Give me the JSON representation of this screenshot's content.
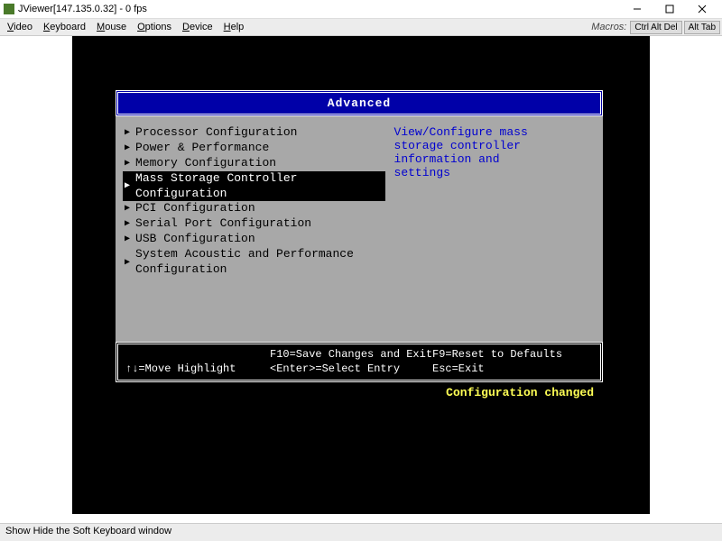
{
  "window": {
    "title": "JViewer[147.135.0.32] - 0 fps",
    "min_label": "Minimize",
    "max_label": "Maximize",
    "close_label": "Close"
  },
  "menus": {
    "items": [
      "Video",
      "Keyboard",
      "Mouse",
      "Options",
      "Device",
      "Help"
    ],
    "macros_label": "Macros:",
    "macro_buttons": [
      "Ctrl Alt Del",
      "Alt Tab"
    ]
  },
  "bios": {
    "header": "Advanced",
    "menu_items": [
      "Processor Configuration",
      "Power & Performance",
      "Memory Configuration",
      "Mass Storage Controller Configuration",
      "PCI Configuration",
      "Serial Port Configuration",
      "USB Configuration",
      "System Acoustic and Performance Configuration"
    ],
    "selected_index": 3,
    "help_text": "View/Configure mass\nstorage controller\ninformation and\nsettings",
    "footer": {
      "row1": {
        "col1": "",
        "col2": "F10=Save Changes and Exit",
        "col3": "F9=Reset to Defaults"
      },
      "row2": {
        "col1": "↑↓=Move Highlight",
        "col2": "<Enter>=Select Entry",
        "col3": "Esc=Exit"
      }
    },
    "status": "Configuration changed"
  },
  "statusbar": {
    "text": "Show Hide the Soft Keyboard window"
  }
}
